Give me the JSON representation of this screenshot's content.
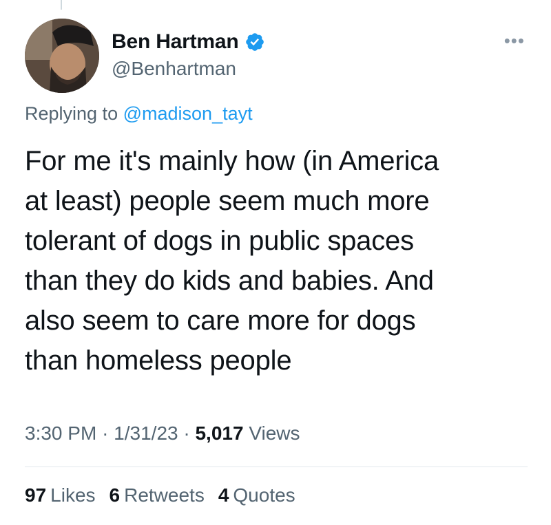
{
  "author": {
    "display_name": "Ben Hartman",
    "handle": "@Benhartman",
    "verified": true,
    "verified_color": "#1d9bf0"
  },
  "reply": {
    "prefix": "Replying to",
    "mention": "@madison_tayt",
    "mention_color": "#1d9bf0"
  },
  "tweet": {
    "text": "For me it's mainly how (in America\nat least) people seem much more\ntolerant of dogs in public spaces\nthan they do kids and babies. And\nalso seem to care more for dogs\nthan homeless people"
  },
  "meta": {
    "time": "3:30 PM",
    "sep1": "·",
    "date": "1/31/23",
    "sep2": "·",
    "views_count": "5,017",
    "views_label": "Views"
  },
  "stats": {
    "likes_count": "97",
    "likes_label": "Likes",
    "retweets_count": "6",
    "retweets_label": "Retweets",
    "quotes_count": "4",
    "quotes_label": "Quotes"
  },
  "icons": {
    "more": "more-icon",
    "verified": "verified-badge-icon"
  }
}
